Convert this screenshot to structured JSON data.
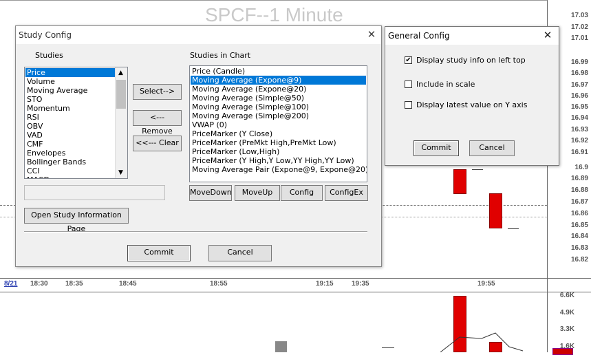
{
  "chart": {
    "title": "SPCF--1 Minute",
    "y_labels": [
      "17.03",
      "17.02",
      "17.01",
      "16.99",
      "16.98",
      "16.97",
      "16.96",
      "16.95",
      "16.94",
      "16.93",
      "16.92",
      "16.91",
      "16.9",
      "16.89",
      "16.88",
      "16.87",
      "16.86",
      "16.85",
      "16.84",
      "16.83",
      "16.82"
    ],
    "x_labels": [
      "8/21",
      "18:30",
      "18:35",
      "18:45",
      "18:55",
      "19:15",
      "19:35",
      "19:55"
    ],
    "volume_labels": [
      "6.6K",
      "4.9K",
      "3.3K",
      "1.6K"
    ]
  },
  "study_config": {
    "title": "Study Config",
    "close_glyph": "✕",
    "studies_label": "Studies",
    "studies": [
      "Price",
      "Volume",
      "Moving Average",
      "STO",
      "Momentum",
      "RSI",
      "OBV",
      "VAD",
      "CMF",
      "Envelopes",
      "Bollinger Bands",
      "CCI",
      "MACD"
    ],
    "studies_in_chart_label": "Studies in Chart",
    "studies_in_chart": [
      "Price (Candle)",
      "Moving Average (Expone@9)",
      "Moving Average (Expone@20)",
      "Moving Average (Simple@50)",
      "Moving Average (Simple@100)",
      "Moving Average (Simple@200)",
      "VWAP (0)",
      "PriceMarker (Y Close)",
      "PriceMarker (PreMkt High,PreMkt Low)",
      "PriceMarker (Low,High)",
      "PriceMarker (Y High,Y Low,YY High,YY Low)",
      "Moving Average Pair (Expone@9, Expone@20)"
    ],
    "select_btn": "Select-->",
    "remove_btn": "<--- Remove",
    "clear_btn": "<<--- Clear",
    "movedown_btn": "MoveDown",
    "moveup_btn": "MoveUp",
    "config_btn": "Config",
    "configex_btn": "ConfigEx",
    "open_info_btn": "Open Study Information Page",
    "commit_btn": "Commit",
    "cancel_btn": "Cancel"
  },
  "general_config": {
    "title": "General Config",
    "close_glyph": "✕",
    "options": [
      {
        "label": "Display study info on left top",
        "checked": true
      },
      {
        "label": "Include in scale",
        "checked": false
      },
      {
        "label": "Display latest value on Y axis",
        "checked": false
      }
    ],
    "commit_btn": "Commit",
    "cancel_btn": "Cancel"
  }
}
